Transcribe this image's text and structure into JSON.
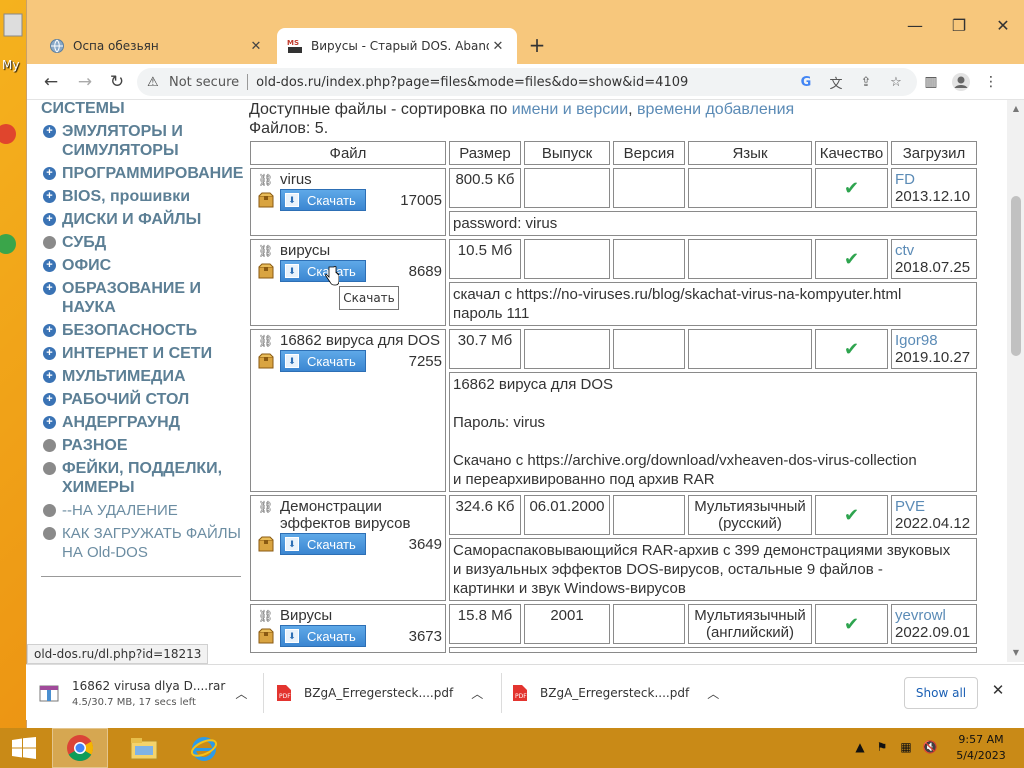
{
  "desktop": {
    "icon_label": "My"
  },
  "browser": {
    "tabs": [
      {
        "title": "Оспа обезьян",
        "favicon": "globe-icon",
        "active": false
      },
      {
        "title": "Вирусы - Старый DOS. Abandon",
        "favicon": "old-dos-favicon",
        "active": true
      }
    ],
    "omnibox": {
      "security_label": "Not secure",
      "url": "old-dos.ru/index.php?page=files&mode=files&do=show&id=4109"
    }
  },
  "sidebar": {
    "categories": [
      {
        "label": "СИСТЕМЫ",
        "bullet": "none"
      },
      {
        "label": "ЭМУЛЯТОРЫ И СИМУЛЯТОРЫ",
        "bullet": "plus"
      },
      {
        "label": "ПРОГРАММИРОВАНИЕ",
        "bullet": "plus"
      },
      {
        "label": "BIOS, прошивки",
        "bullet": "plus"
      },
      {
        "label": "ДИСКИ И ФАЙЛЫ",
        "bullet": "plus"
      },
      {
        "label": "СУБД",
        "bullet": "dot"
      },
      {
        "label": "ОФИС",
        "bullet": "plus"
      },
      {
        "label": "ОБРАЗОВАНИЕ И НАУКА",
        "bullet": "plus"
      },
      {
        "label": "БЕЗОПАСНОСТЬ",
        "bullet": "plus"
      },
      {
        "label": "ИНТЕРНЕТ И СЕТИ",
        "bullet": "plus"
      },
      {
        "label": "МУЛЬТИМЕДИА",
        "bullet": "plus"
      },
      {
        "label": "РАБОЧИЙ СТОЛ",
        "bullet": "plus"
      },
      {
        "label": "АНДЕРГРАУНД",
        "bullet": "plus"
      },
      {
        "label": "РАЗНОЕ",
        "bullet": "dot"
      },
      {
        "label": "ФЕЙКИ, ПОДДЕЛКИ, ХИМЕРЫ",
        "bullet": "dot"
      },
      {
        "label": "--НА УДАЛЕНИЕ",
        "bullet": "dot"
      },
      {
        "label": "КАК ЗАГРУЖАТЬ ФАЙЛЫ НА Old-DOS",
        "bullet": "dot"
      }
    ]
  },
  "files": {
    "sort_prefix": "Доступные файлы - сортировка по ",
    "sort_by_name": "имени и версии",
    "sort_comma": ", ",
    "sort_by_date": "времени добавления",
    "count_label": "Файлов: 5.",
    "headers": [
      "Файл",
      "Размер",
      "Выпуск",
      "Версия",
      "Язык",
      "Качество",
      "Загрузил"
    ],
    "download_label": "Скачать",
    "rows": [
      {
        "name": "virus",
        "downloads": "17005",
        "size": "800.5 Кб",
        "release": "",
        "version": "",
        "language": "",
        "uploader": "FD",
        "date": "2013.12.10",
        "desc": [
          "password: virus"
        ]
      },
      {
        "name": "вирусы",
        "downloads": "8689",
        "size": "10.5 Мб",
        "release": "",
        "version": "",
        "language": "",
        "uploader": "ctv",
        "date": "2018.07.25",
        "desc": [
          "скачал с https://no-viruses.ru/blog/skachat-virus-na-kompyuter.html",
          "пароль 111"
        ]
      },
      {
        "name": "16862 вируса для DOS",
        "downloads": "7255",
        "size": "30.7 Мб",
        "release": "",
        "version": "",
        "language": "",
        "uploader": "Igor98",
        "date": "2019.10.27",
        "desc": [
          "16862 вируса для DOS",
          "",
          "Пароль: virus",
          "",
          "Скачано с https://archive.org/download/vxheaven-dos-virus-collection",
          "и переархивированно под архив RAR"
        ]
      },
      {
        "name": "Демонстрации эффектов вирусов",
        "downloads": "3649",
        "size": "324.6 Кб",
        "release": "06.01.2000",
        "version": "",
        "language": "Мультиязычный (русский)",
        "uploader": "PVE",
        "date": "2022.04.12",
        "desc": [
          "Самораспаковывающийся RAR-архив с 399 демонстрациями звуковых",
          "и визуальных эффектов DOS-вирусов, остальные 9 файлов -",
          "картинки и звук Windows-вирусов"
        ]
      },
      {
        "name": "Вирусы",
        "downloads": "3673",
        "size": "15.8 Мб",
        "release": "2001",
        "version": "",
        "language": "Мультиязычный (английский)",
        "uploader": "yevrowl",
        "date": "2022.09.01",
        "desc": []
      }
    ]
  },
  "tooltip": "Скачать",
  "status_url": "old-dos.ru/dl.php?id=18213",
  "downloads_shelf": {
    "items": [
      {
        "name": "16862 virusa dlya D....rar",
        "sub": "4.5/30.7 MB, 17 secs left",
        "icon": "archive-icon"
      },
      {
        "name": "BZgA_Erregersteck....pdf",
        "sub": "",
        "icon": "pdf-icon"
      },
      {
        "name": "BZgA_Erregersteck....pdf",
        "sub": "",
        "icon": "pdf-icon"
      }
    ],
    "show_all": "Show all"
  },
  "taskbar": {
    "time": "9:57 AM",
    "date": "5/4/2023"
  },
  "colors": {
    "accent": "#5b8bb6",
    "category": "#5c7f95",
    "check": "#2ea44f",
    "download_button": "#3b86d1"
  }
}
